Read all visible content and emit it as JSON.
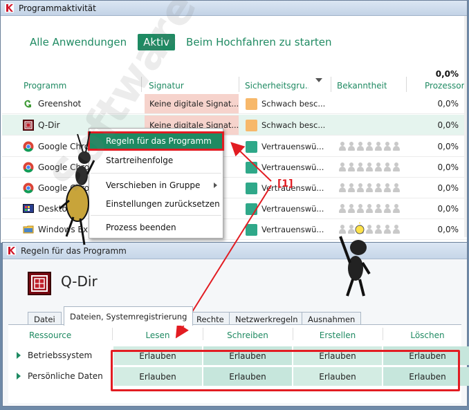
{
  "window1": {
    "title": "Programmaktivität",
    "tabs": [
      {
        "label": "Alle Anwendungen",
        "active": false
      },
      {
        "label": "Aktiv",
        "active": true
      },
      {
        "label": "Beim Hochfahren zu starten",
        "active": false
      }
    ],
    "cpu_total": "0,0%",
    "columns": {
      "program": "Programm",
      "signature": "Signatur",
      "security": "Sicherheitsgru...",
      "reputation": "Bekanntheitsgr...",
      "cpu": "Prozessor"
    },
    "rows": [
      {
        "program": "Greenshot",
        "signature": "Keine digitale Signat...",
        "security": "Schwach besc...",
        "cpu": "0,0%",
        "icon": "greenshot-icon"
      },
      {
        "program": "Q-Dir",
        "signature": "Keine digitale Signat...",
        "security": "Schwach besc...",
        "cpu": "0,0%",
        "icon": "q-dir-icon"
      },
      {
        "program": "Google Chrome",
        "signature": "",
        "security": "Vertrauenswü...",
        "cpu": "0,0%",
        "icon": "chrome-icon"
      },
      {
        "program": "Google Chrome",
        "signature": "",
        "security": "Vertrauenswü...",
        "cpu": "0,0%",
        "icon": "chrome-icon"
      },
      {
        "program": "Google Chrome",
        "signature": "",
        "security": "Vertrauenswü...",
        "cpu": "0,0%",
        "icon": "chrome-icon"
      },
      {
        "program": "DesktopOK",
        "signature": "",
        "security": "Vertrauenswü...",
        "cpu": "0,0%",
        "icon": "desktopok-icon"
      },
      {
        "program": "Windows Explorer",
        "signature": "",
        "security": "Vertrauenswü...",
        "cpu": "0,0%",
        "icon": "folder-icon"
      }
    ]
  },
  "context_menu": {
    "items": [
      "Regeln für das Programm",
      "Startreihenfolge",
      "Verschieben in Gruppe",
      "Einstellungen zurücksetzen",
      "Prozess beenden"
    ]
  },
  "annotation": "[1]",
  "watermark": "SoftwareOK.de",
  "window2": {
    "title": "Regeln für das Programm",
    "program_name": "Q-Dir",
    "tabs": [
      "Datei",
      "Dateien, Systemregistrierung",
      "Rechte",
      "Netzwerkregeln",
      "Ausnahmen"
    ],
    "columns": [
      "Ressource",
      "Lesen",
      "Schreiben",
      "Erstellen",
      "Löschen"
    ],
    "rows": [
      {
        "resource": "Betriebssystem",
        "values": [
          "Erlauben",
          "Erlauben",
          "Erlauben",
          "Erlauben"
        ]
      },
      {
        "resource": "Persönliche Daten",
        "values": [
          "Erlauben",
          "Erlauben",
          "Erlauben",
          "Erlauben"
        ]
      }
    ]
  },
  "colors": {
    "accent": "#1e8a62",
    "highlight_red": "#e21c22",
    "weak_security": "#f7b86a",
    "trusted_security": "#2fa889",
    "no_signature_bg": "#f6d3cc"
  }
}
